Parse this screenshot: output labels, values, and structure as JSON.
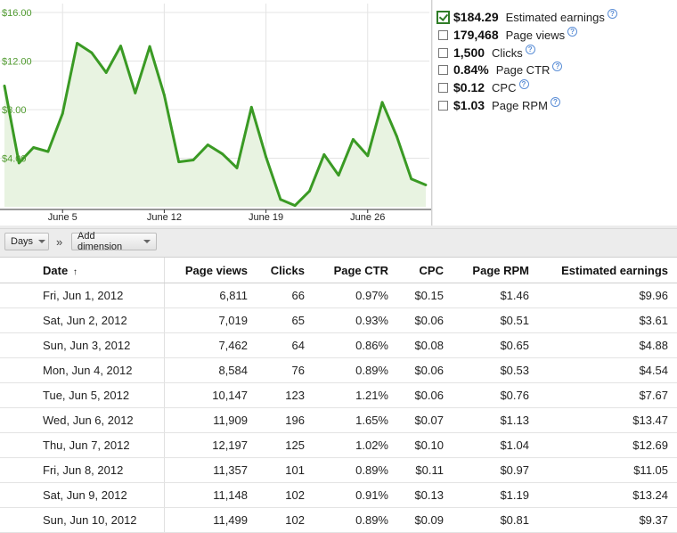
{
  "chart_data": {
    "type": "area",
    "x": [
      "Jun 1",
      "Jun 2",
      "Jun 3",
      "Jun 4",
      "Jun 5",
      "Jun 6",
      "Jun 7",
      "Jun 8",
      "Jun 9",
      "Jun 10",
      "Jun 11",
      "Jun 12",
      "Jun 13",
      "Jun 14",
      "Jun 15",
      "Jun 16",
      "Jun 17",
      "Jun 18",
      "Jun 19",
      "Jun 20",
      "Jun 21",
      "Jun 22",
      "Jun 23",
      "Jun 24",
      "Jun 25",
      "Jun 26",
      "Jun 27",
      "Jun 28",
      "Jun 29",
      "Jun 30"
    ],
    "series": [
      {
        "name": "Estimated earnings",
        "values": [
          9.96,
          3.61,
          4.88,
          4.54,
          7.67,
          13.47,
          12.69,
          11.05,
          13.24,
          9.37,
          13.2,
          9.2,
          3.7,
          3.85,
          5.1,
          4.35,
          3.2,
          8.2,
          4.1,
          0.6,
          0.1,
          1.3,
          4.3,
          2.6,
          5.55,
          4.2,
          8.6,
          5.8,
          2.3,
          1.8
        ]
      }
    ],
    "ylim": [
      0,
      16
    ],
    "y_ticks": [
      "$4.00",
      "$8.00",
      "$12.00",
      "$16.00"
    ],
    "y_tick_values": [
      4,
      8,
      12,
      16
    ],
    "x_ticks": [
      "June 5",
      "June 12",
      "June 19",
      "June 26"
    ],
    "x_tick_values": [
      "Jun 5",
      "Jun 12",
      "Jun 19",
      "Jun 26"
    ],
    "grid": true,
    "colors": {
      "line": "#3a9a24",
      "fill": "#e8f3e1",
      "tick_text": "#4f9a2e"
    }
  },
  "metrics": [
    {
      "value": "$184.29",
      "label": "Estimated earnings",
      "checked": true
    },
    {
      "value": "179,468",
      "label": "Page views",
      "checked": false
    },
    {
      "value": "1,500",
      "label": "Clicks",
      "checked": false
    },
    {
      "value": "0.84%",
      "label": "Page CTR",
      "checked": false
    },
    {
      "value": "$0.12",
      "label": "CPC",
      "checked": false
    },
    {
      "value": "$1.03",
      "label": "Page RPM",
      "checked": false
    }
  ],
  "help_glyph": "?",
  "toolbar": {
    "days_label": "Days",
    "separator": "»",
    "add_dimension_label": "Add dimension"
  },
  "table": {
    "columns": [
      "Date",
      "Page views",
      "Clicks",
      "Page CTR",
      "CPC",
      "Page RPM",
      "Estimated earnings"
    ],
    "sort_indicator": "↑",
    "rows": [
      [
        "Fri, Jun 1, 2012",
        "6,811",
        "66",
        "0.97%",
        "$0.15",
        "$1.46",
        "$9.96"
      ],
      [
        "Sat, Jun 2, 2012",
        "7,019",
        "65",
        "0.93%",
        "$0.06",
        "$0.51",
        "$3.61"
      ],
      [
        "Sun, Jun 3, 2012",
        "7,462",
        "64",
        "0.86%",
        "$0.08",
        "$0.65",
        "$4.88"
      ],
      [
        "Mon, Jun 4, 2012",
        "8,584",
        "76",
        "0.89%",
        "$0.06",
        "$0.53",
        "$4.54"
      ],
      [
        "Tue, Jun 5, 2012",
        "10,147",
        "123",
        "1.21%",
        "$0.06",
        "$0.76",
        "$7.67"
      ],
      [
        "Wed, Jun 6, 2012",
        "11,909",
        "196",
        "1.65%",
        "$0.07",
        "$1.13",
        "$13.47"
      ],
      [
        "Thu, Jun 7, 2012",
        "12,197",
        "125",
        "1.02%",
        "$0.10",
        "$1.04",
        "$12.69"
      ],
      [
        "Fri, Jun 8, 2012",
        "11,357",
        "101",
        "0.89%",
        "$0.11",
        "$0.97",
        "$11.05"
      ],
      [
        "Sat, Jun 9, 2012",
        "11,148",
        "102",
        "0.91%",
        "$0.13",
        "$1.19",
        "$13.24"
      ],
      [
        "Sun, Jun 10, 2012",
        "11,499",
        "102",
        "0.89%",
        "$0.09",
        "$0.81",
        "$9.37"
      ]
    ]
  }
}
